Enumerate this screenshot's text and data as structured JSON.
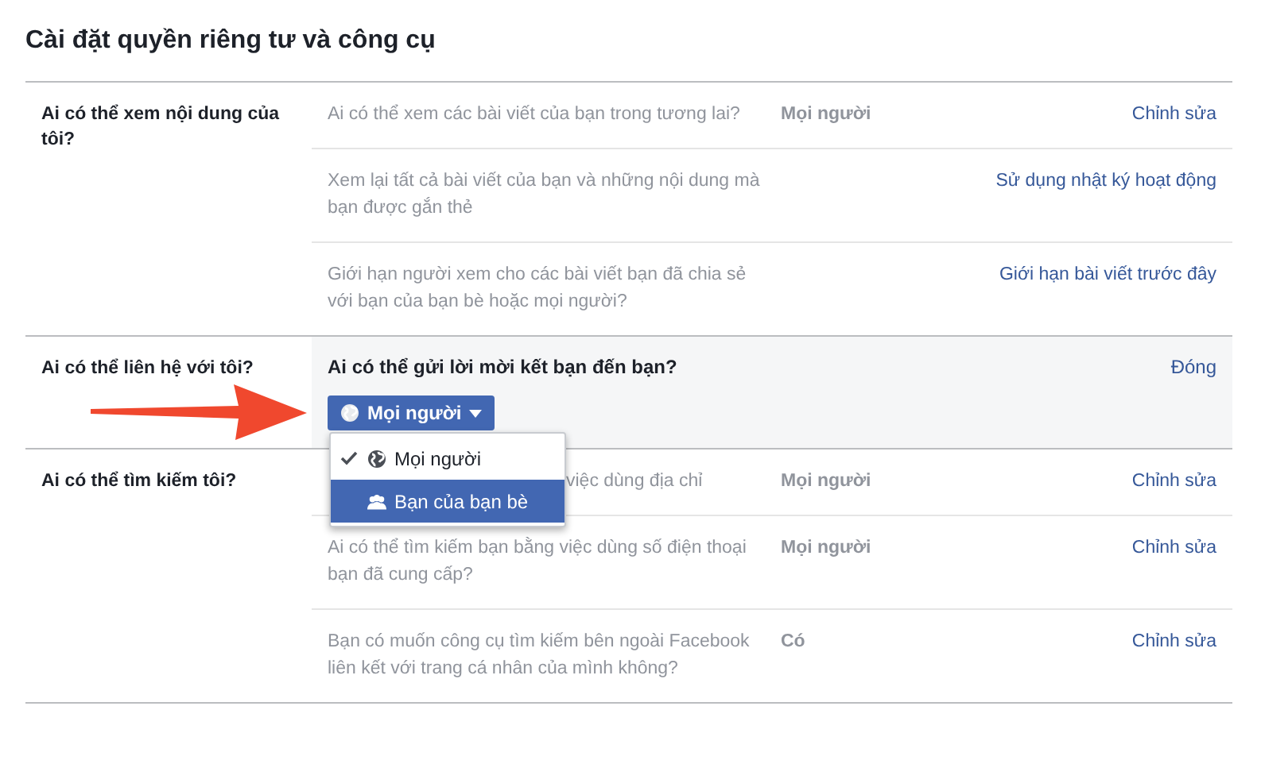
{
  "title": "Cài đặt quyền riêng tư và công cụ",
  "sections": [
    {
      "kind": "list",
      "label": "Ai có thể xem nội dung của tôi?",
      "rows": [
        {
          "question": "Ai có thể xem các bài viết của bạn trong tương lai?",
          "value": "Mọi người",
          "action": "Chỉnh sửa",
          "covered": false
        },
        {
          "question": "Xem lại tất cả bài viết của bạn và những nội dung mà bạn được gắn thẻ",
          "action": "Sử dụng nhật ký hoạt động",
          "covered": false
        },
        {
          "question": "Giới hạn người xem cho các bài viết bạn đã chia sẻ với bạn của bạn bè hoặc mọi người?",
          "action": "Giới hạn bài viết trước đây",
          "covered": false
        }
      ]
    },
    {
      "kind": "editor",
      "label": "Ai có thể liên hệ với tôi?",
      "question": "Ai có thể gửi lời mời kết bạn đến bạn?",
      "action": "Đóng",
      "button": "Mọi người",
      "menu": [
        {
          "kind": "globe",
          "label": "Mọi người",
          "checked": true,
          "selected": false
        },
        {
          "kind": "friends",
          "label": "Bạn của bạn bè",
          "checked": false,
          "selected": true
        }
      ]
    },
    {
      "kind": "list",
      "label": "Ai có thể tìm kiếm tôi?",
      "rows": [
        {
          "question": "việc dùng địa chỉ",
          "value": "Mọi người",
          "action": "Chỉnh sửa",
          "covered": true
        },
        {
          "question": "Ai có thể tìm kiếm bạn bằng việc dùng số điện thoại bạn đã cung cấp?",
          "value": "Mọi người",
          "action": "Chỉnh sửa",
          "covered": false
        },
        {
          "question": "Bạn có muốn công cụ tìm kiếm bên ngoài Facebook liên kết với trang cá nhân của mình không?",
          "value": "Có",
          "action": "Chỉnh sửa",
          "covered": false
        }
      ]
    }
  ]
}
